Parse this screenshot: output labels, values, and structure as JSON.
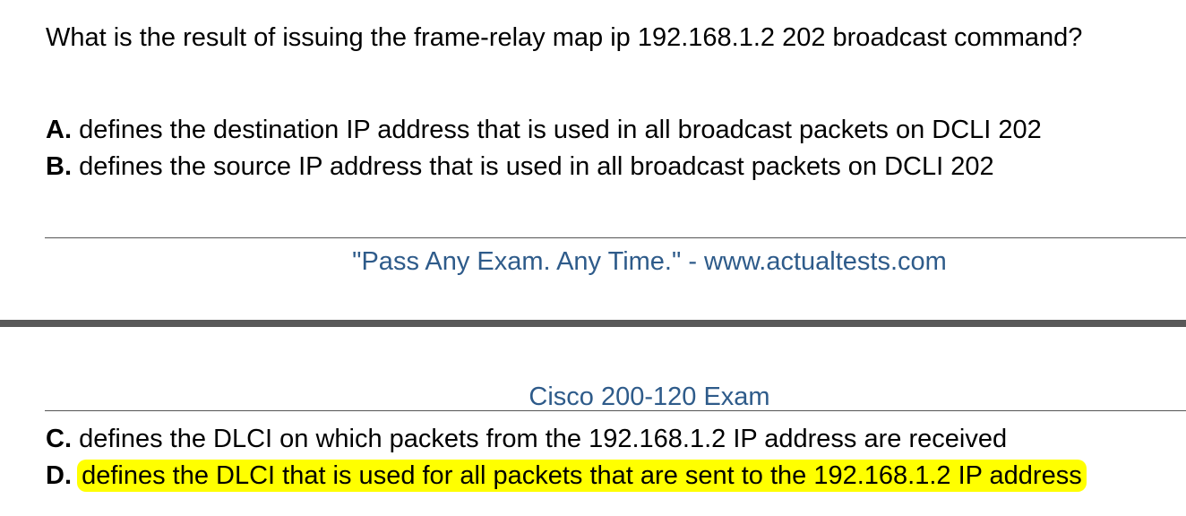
{
  "question": "What is the result of issuing the frame-relay map ip 192.168.1.2 202 broadcast command?",
  "options": [
    {
      "letter": "A.",
      "text": "defines the destination IP address that is used in all broadcast packets on DCLI 202"
    },
    {
      "letter": "B.",
      "text": "defines the source IP address that is used in all broadcast packets on DCLI 202"
    },
    {
      "letter": "C.",
      "text": "defines the DLCI on which packets from the 192.168.1.2 IP address are received"
    },
    {
      "letter": "D.",
      "text": "defines the DLCI that is used for all packets that are sent to the 192.168.1.2 IP address"
    }
  ],
  "footer": {
    "slogan": "\"Pass Any Exam. Any Time.\" - www.actualtests.com"
  },
  "header": {
    "exam_title": "Cisco 200-120 Exam"
  },
  "colors": {
    "link_blue": "#2e5b8a",
    "highlight": "#ffff00",
    "page_break": "#595959"
  }
}
